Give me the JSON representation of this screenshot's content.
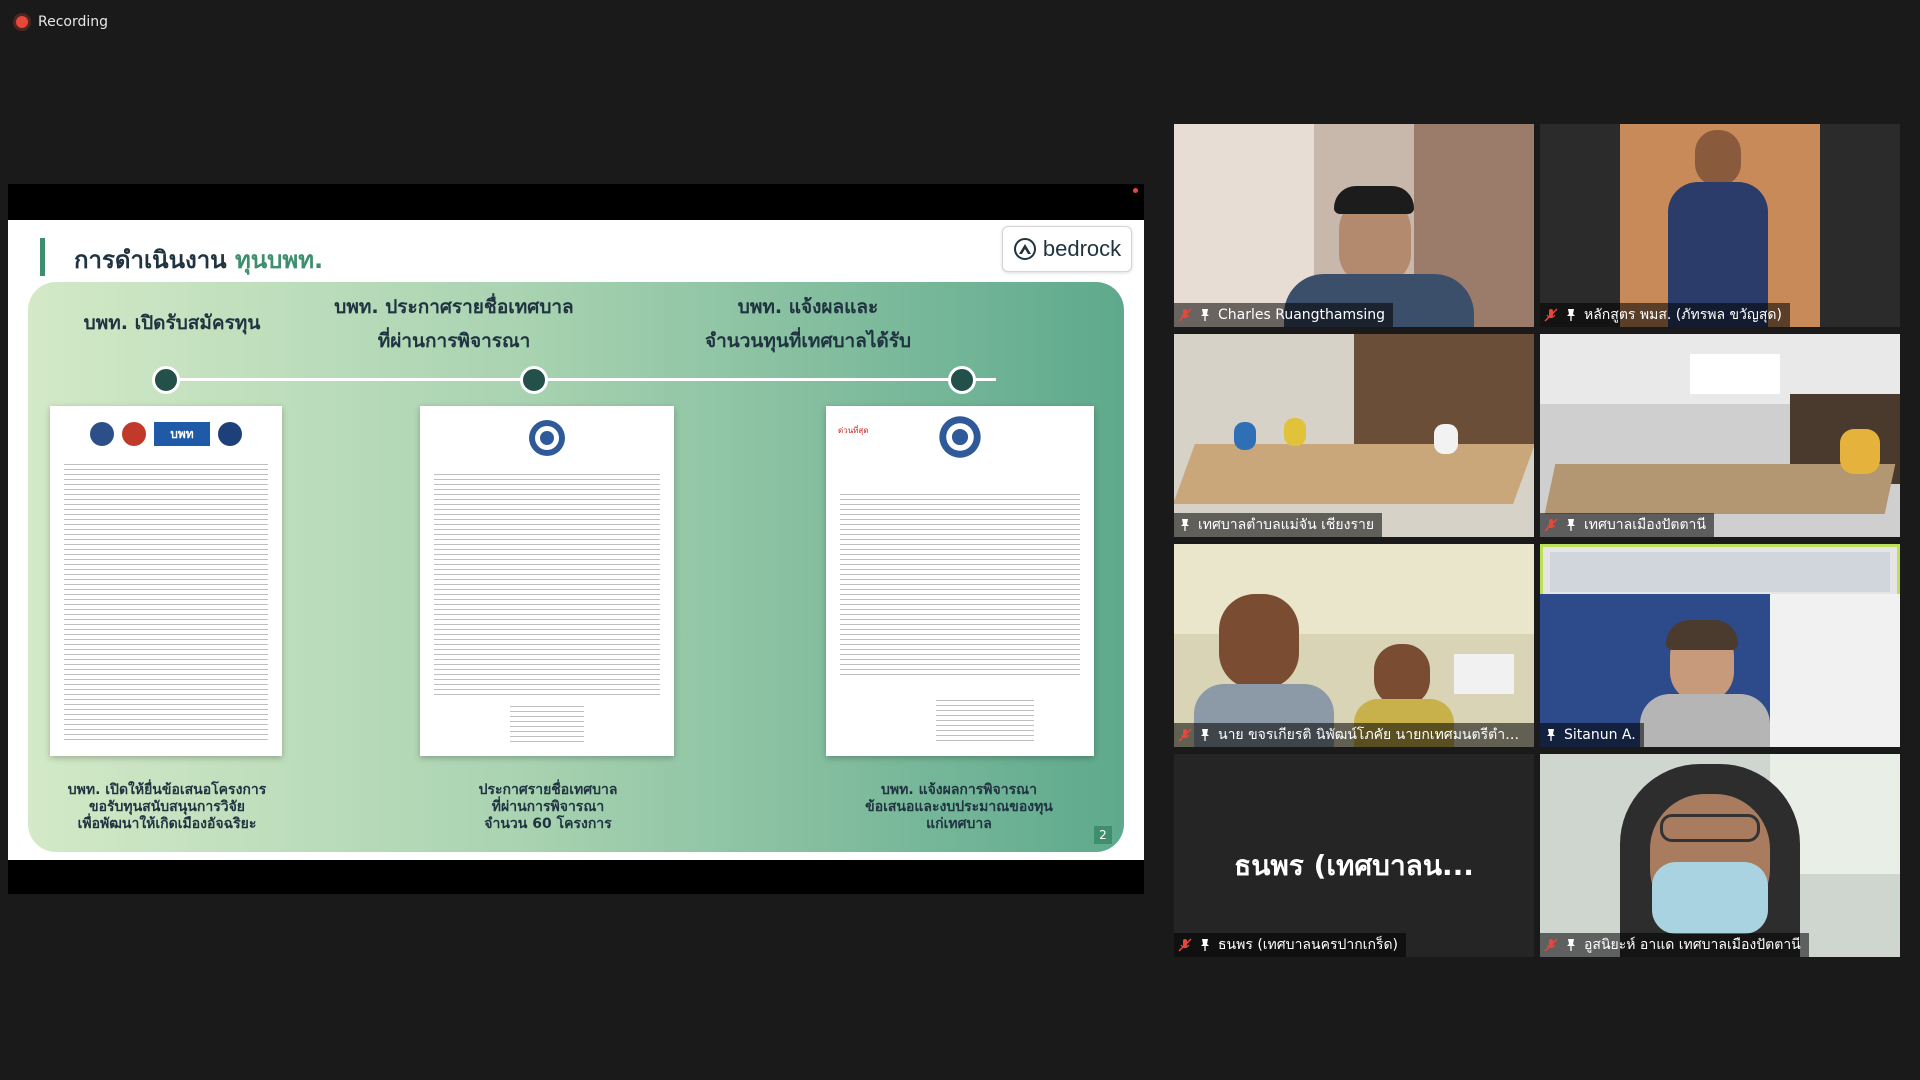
{
  "recording": {
    "label": "Recording",
    "color": "#e8473a"
  },
  "slide": {
    "title_prefix": "การดำเนินงาน",
    "title_accent": "ทุนบพท.",
    "logo_text": "bedrock",
    "page_number": "2",
    "accent": "#3f8f6f",
    "steps": [
      {
        "head_lines": [
          "บพท. เปิดรับสมัครทุน"
        ],
        "foot_lines": [
          "บพท. เปิดให้ยื่นข้อเสนอโครงการ",
          "ขอรับทุนสนับสนุนการวิจัย",
          "เพื่อพัฒนาให้เกิดเมืองอัจฉริยะ"
        ],
        "doc_badge": "บพท"
      },
      {
        "head_lines": [
          "บพท. ประกาศรายชื่อเทศบาล",
          "ที่ผ่านการพิจารณา"
        ],
        "foot_lines": [
          "ประกาศรายชื่อเทศบาล",
          "ที่ผ่านการพิจารณา",
          "จำนวน 60 โครงการ"
        ]
      },
      {
        "head_lines": [
          "บพท. แจ้งผลและ",
          "จำนวนทุนที่เทศบาลได้รับ"
        ],
        "foot_lines": [
          "บพท. แจ้งผลการพิจารณา",
          "ข้อเสนอและงบประมาณของทุน",
          "แก่เทศบาล"
        ],
        "doc_red": "ด่วนที่สุด"
      }
    ]
  },
  "participants": [
    {
      "name": "Charles Ruangthamsing",
      "muted": true,
      "scene": "person-desk"
    },
    {
      "name": "หลักสูตร พมส. (ภัทรพล ขวัญสุด)",
      "muted": true,
      "scene": "person-standing"
    },
    {
      "name": "เทศบาลตำบลแม่จัน เชียงราย",
      "muted": false,
      "scene": "meeting-room"
    },
    {
      "name": "เทศบาลเมืองปัตตานี",
      "muted": true,
      "scene": "meeting-room-2"
    },
    {
      "name": "นาย ขจรเกียรติ นิพัฒน์โภคัย นายกเทศมนตรีตำบ...",
      "muted": true,
      "scene": "two-people"
    },
    {
      "name": "Sitanun A.",
      "muted": false,
      "active": true,
      "scene": "office"
    },
    {
      "name": "ธนพร (เทศบาลนครปากเกร็ด)",
      "muted": true,
      "display_name": "ธนพร (เทศบาลน...",
      "scene": "no-video"
    },
    {
      "name": "อูสนิยะห์ อาแด เทศบาลเมืองปัตตานี",
      "muted": true,
      "scene": "person-mask"
    }
  ]
}
